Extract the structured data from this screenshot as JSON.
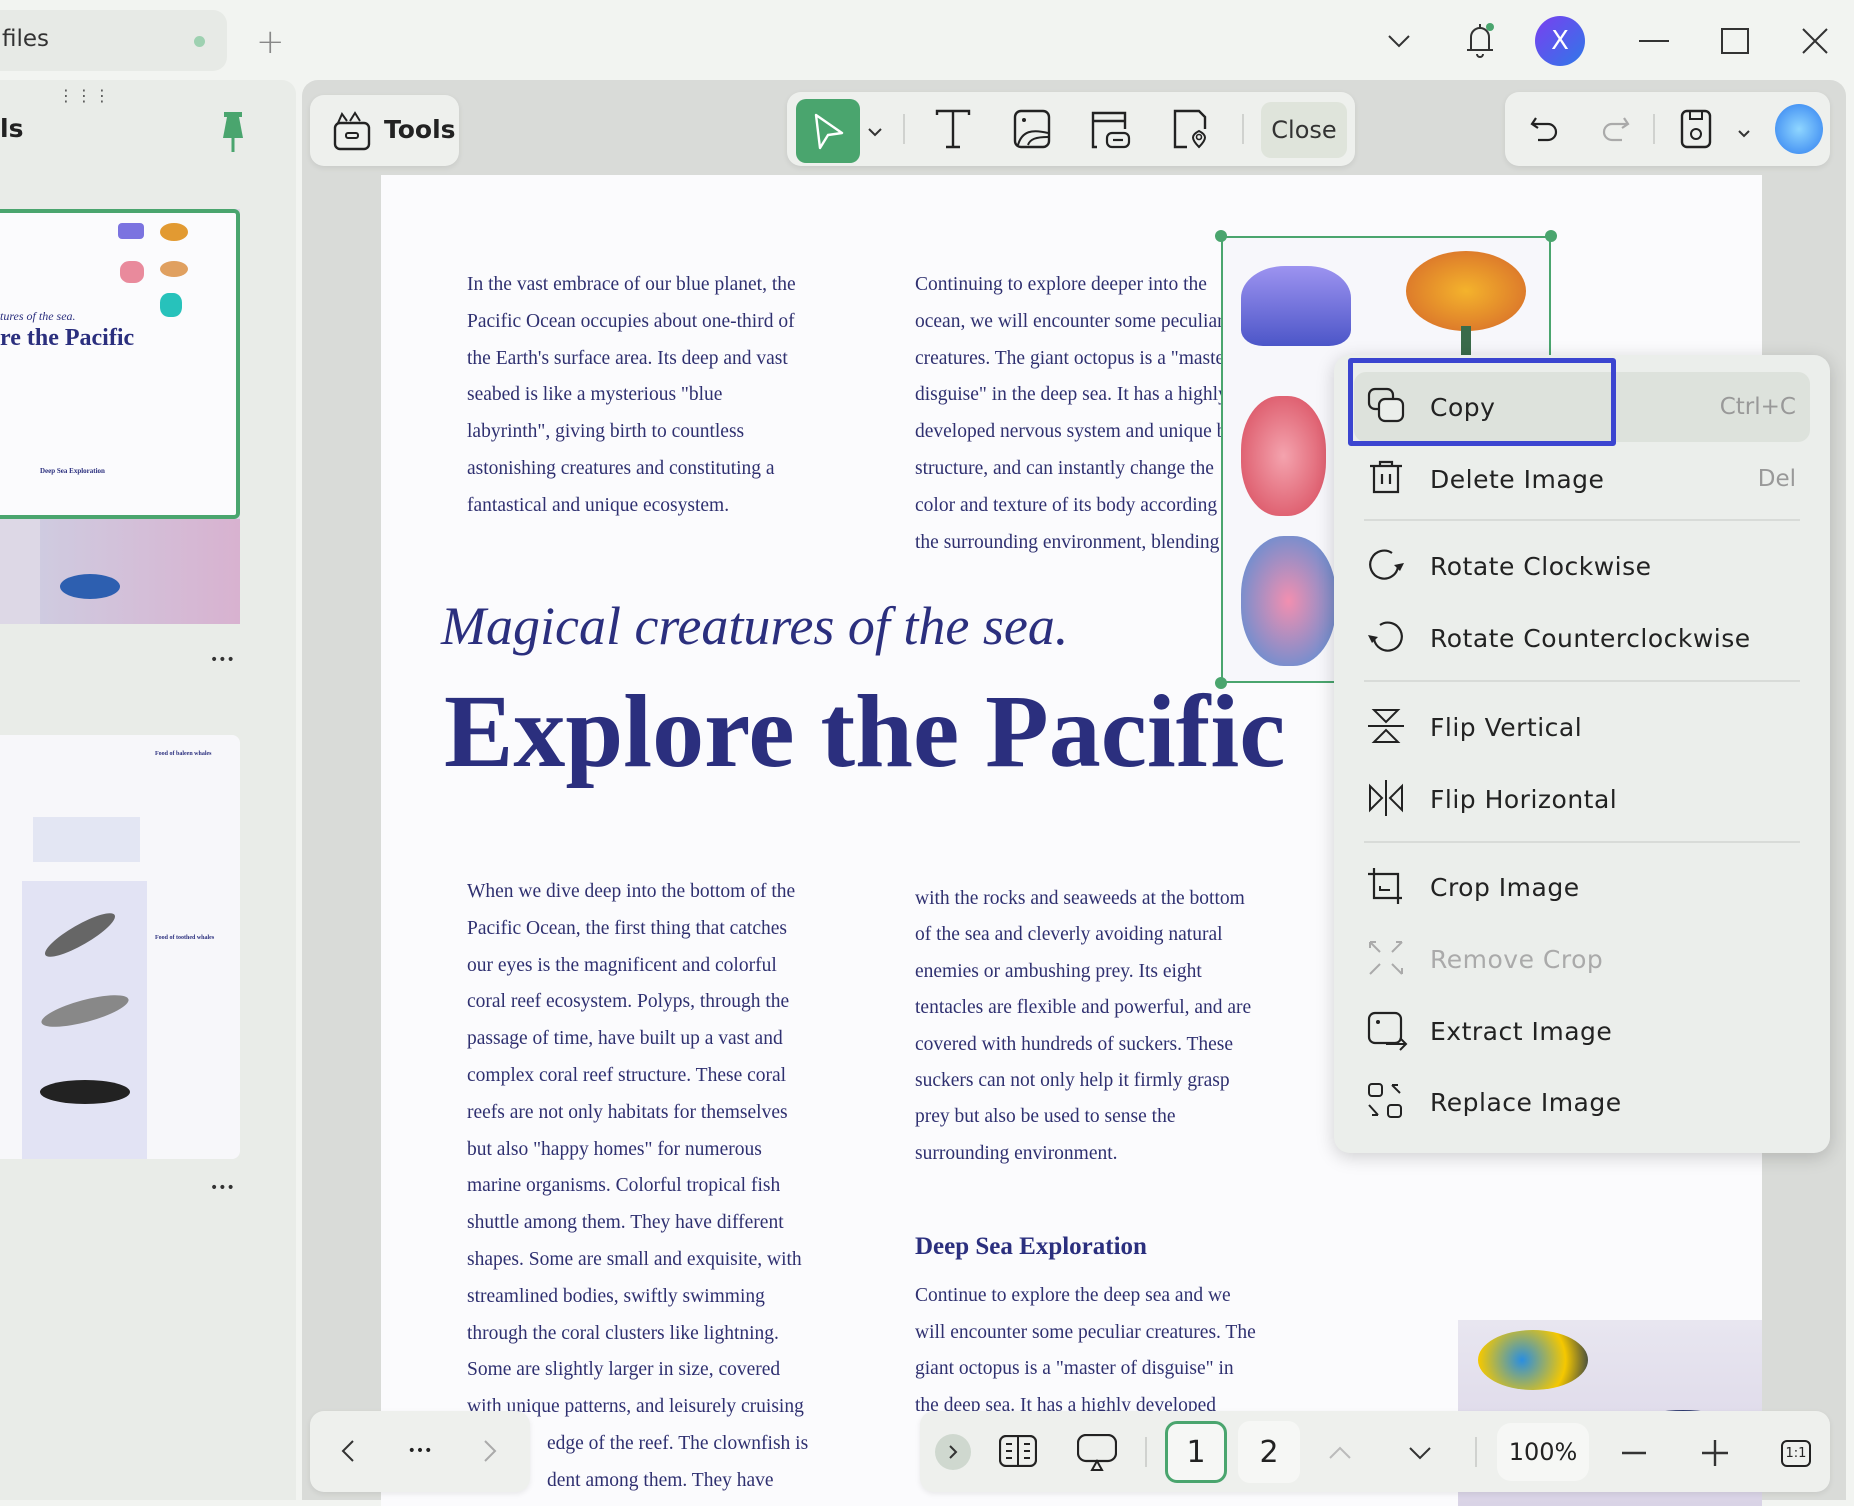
{
  "tabbar": {
    "tab_label": "files",
    "new_tab": "+"
  },
  "window": {
    "avatar_letter": "X"
  },
  "panel": {
    "title": "ls",
    "thumb1_subtitle": "tures of the sea.",
    "thumb1_title": "re the Pacific",
    "thumb1_heading": "Deep Sea Exploration",
    "thumb2_heading1": "Food of baleen whales",
    "thumb2_heading2": "Food of toothed whales",
    "more": "•••"
  },
  "toolbar": {
    "tools_label": "Tools",
    "close_label": "Close"
  },
  "doc": {
    "col1_top": [
      "In the vast embrace of our blue planet, the",
      "Pacific Ocean occupies about one-third of",
      "the Earth's surface area. Its deep and vast",
      "seabed is like a mysterious \"blue",
      "labyrinth\", giving birth to countless",
      "astonishing creatures and constituting a",
      "fantastical and unique ecosystem."
    ],
    "col2_top": [
      "Continuing to explore deeper into the",
      "ocean, we will encounter some peculiar",
      "creatures. The giant octopus is a \"master of",
      "disguise\" in the deep sea. It has a highly",
      "developed nervous system and unique body",
      "structure, and can instantly change the",
      "color and texture of its body according to",
      "the surrounding environment, blending in"
    ],
    "subtitle": "Magical creatures of the sea.",
    "title": "Explore the Pacific",
    "col1_bottom": [
      "When we dive deep into the bottom of the",
      "Pacific Ocean, the first thing that catches",
      "our eyes is the magnificent and colorful",
      "coral reef ecosystem. Polyps, through the",
      "passage of time, have built up a vast and",
      "complex coral reef structure. These coral",
      "reefs are not only habitats for themselves",
      "but also \"happy homes\" for numerous",
      "marine organisms. Colorful tropical fish",
      "shuttle among them. They have different",
      "shapes. Some are small and exquisite, with",
      "streamlined bodies, swiftly swimming",
      "through the coral clusters like lightning.",
      "Some are slightly larger in size, covered",
      "with unique patterns, and leisurely cruising",
      "edge of the reef. The clownfish is",
      "dent among them. They have"
    ],
    "col2_bottom": [
      "with the rocks and seaweeds at the bottom",
      "of the sea and cleverly avoiding natural",
      "enemies or ambushing prey. Its eight",
      "tentacles are flexible and powerful, and are",
      "covered with hundreds of suckers. These",
      "suckers can not only help it firmly grasp",
      "prey but also be used to sense the",
      "surrounding environment."
    ],
    "deep_heading": "Deep Sea Exploration",
    "col2_deep": [
      "Continue to explore the deep sea and we",
      "will encounter some peculiar creatures. The",
      "giant octopus is a \"master of disguise\" in",
      "the deep sea. It has a highly developed"
    ]
  },
  "context_menu": {
    "items": [
      {
        "label": "Copy",
        "shortcut": "Ctrl+C",
        "icon": "copy-icon"
      },
      {
        "label": "Delete Image",
        "shortcut": "Del",
        "icon": "trash-icon"
      },
      {
        "label": "Rotate Clockwise",
        "icon": "rotate-cw-icon"
      },
      {
        "label": "Rotate Counterclockwise",
        "icon": "rotate-ccw-icon"
      },
      {
        "label": "Flip Vertical",
        "icon": "flip-vertical-icon"
      },
      {
        "label": "Flip Horizontal",
        "icon": "flip-horizontal-icon"
      },
      {
        "label": "Crop Image",
        "icon": "crop-icon"
      },
      {
        "label": "Remove Crop",
        "icon": "remove-crop-icon",
        "disabled": true
      },
      {
        "label": "Extract Image",
        "icon": "extract-image-icon"
      },
      {
        "label": "Replace Image",
        "icon": "replace-image-icon"
      }
    ]
  },
  "bottom": {
    "more": "•••",
    "page1": "1",
    "page2": "2",
    "zoom": "100%",
    "fit": "1:1"
  },
  "colors": {
    "accent": "#4aa56e",
    "title": "#2b2f7e",
    "highlight": "#3b45d0"
  }
}
